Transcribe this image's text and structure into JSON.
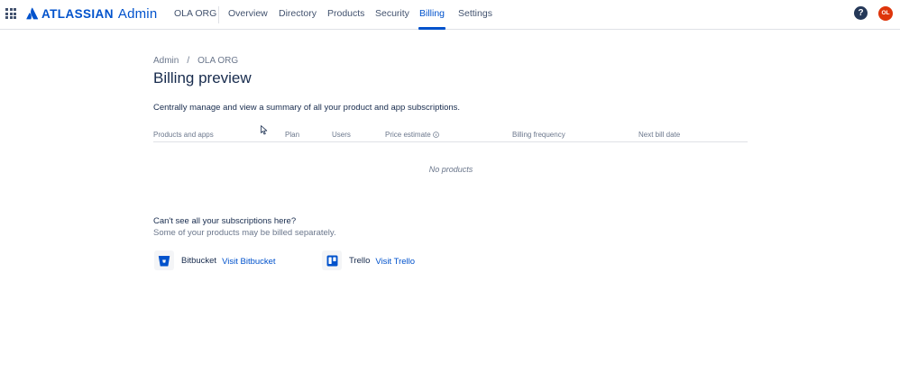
{
  "brand": {
    "name": "ATLASSIAN",
    "product": "Admin",
    "color": "#0052cc"
  },
  "nav": {
    "org": "OLA ORG",
    "items": [
      {
        "label": "Overview"
      },
      {
        "label": "Directory"
      },
      {
        "label": "Products"
      },
      {
        "label": "Security"
      },
      {
        "label": "Billing",
        "active": true
      },
      {
        "label": "Settings"
      }
    ],
    "help": "?",
    "avatar_initials": "OL",
    "avatar_color": "#de350b"
  },
  "breadcrumb": {
    "items": [
      "Admin",
      "OLA ORG"
    ],
    "separator": "/"
  },
  "page": {
    "title": "Billing preview",
    "description": "Centrally manage and view a summary of all your product and app subscriptions."
  },
  "table": {
    "columns": [
      "Products and apps",
      "Plan",
      "Users",
      "Price estimate",
      "Billing frequency",
      "Next bill date"
    ],
    "empty_message": "No products"
  },
  "other_billing": {
    "heading": "Can't see all your subscriptions here?",
    "subtext": "Some of your products may be billed separately.",
    "products": [
      {
        "name": "Bitbucket",
        "link": "Visit Bitbucket",
        "icon": "bitbucket-icon",
        "color": "#0052cc"
      },
      {
        "name": "Trello",
        "link": "Visit Trello",
        "icon": "trello-icon",
        "color": "#0052cc"
      }
    ]
  }
}
